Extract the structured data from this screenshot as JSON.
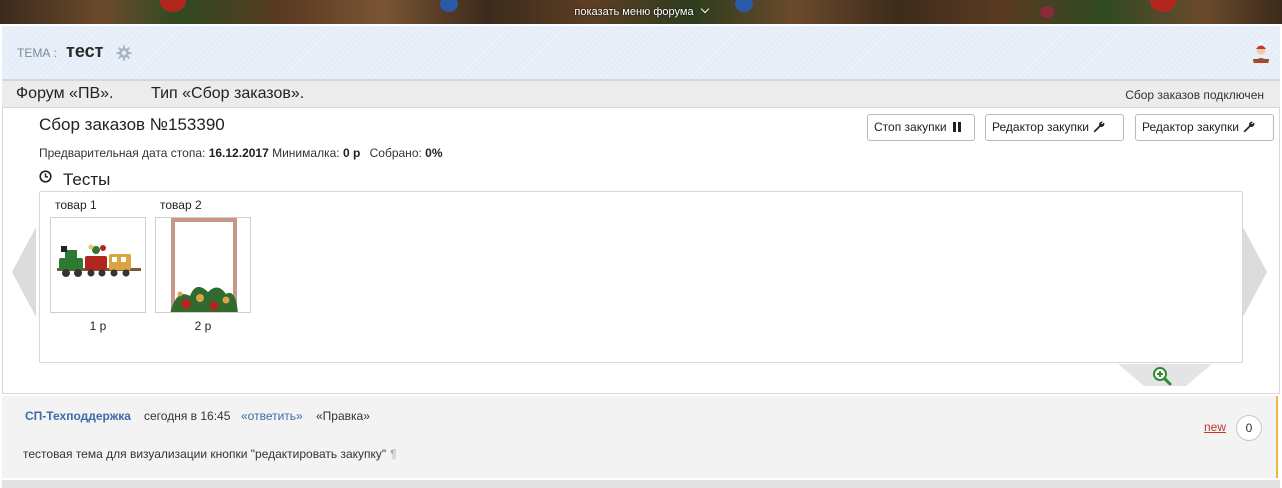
{
  "banner": {
    "menu_label": "показать меню форума",
    "chevron_icon": "chevron-down-icon"
  },
  "topic": {
    "prefix": "ТЕМА :",
    "title": "тест",
    "settings_icon": "gear-icon",
    "user_icon": "avatar-icon"
  },
  "info_bar": {
    "forum": "Форум «ПВ».",
    "type": "Тип «Сбор заказов».",
    "status": "Сбор заказов подключен"
  },
  "order": {
    "title": "Сбор заказов №153390",
    "stop_date_label": "Предварительная дата стопа:",
    "stop_date_value": "16.12.2017",
    "min_label": "Минималка:",
    "min_value": "0 р",
    "collected_label": "Собрано:",
    "collected_value": "0%",
    "buttons": {
      "stop": "Стоп закупки",
      "editor_1": "Редактор закупки",
      "editor_2": "Редактор закупки"
    },
    "category": {
      "icon": "clock-icon",
      "title": "Тесты"
    },
    "products": [
      {
        "name": "товар 1",
        "price": "1 р"
      },
      {
        "name": "товар 2",
        "price": "2 р"
      }
    ],
    "zoom_icon": "zoom-in-icon"
  },
  "post": {
    "author": "СП-Техподдержка",
    "time": "сегодня в 16:45",
    "reply": "«ответить»",
    "edit": "«Правка»",
    "text": "тестовая тема для визуализации кнопки \"редактировать закупку\"",
    "pilcrow": "¶",
    "new_label": "new",
    "count": "0"
  },
  "colors": {
    "link": "#3e6aa8",
    "new_link": "#c0392b",
    "post_accent": "#f0b73c",
    "zoom_green": "#2e8b2e"
  }
}
